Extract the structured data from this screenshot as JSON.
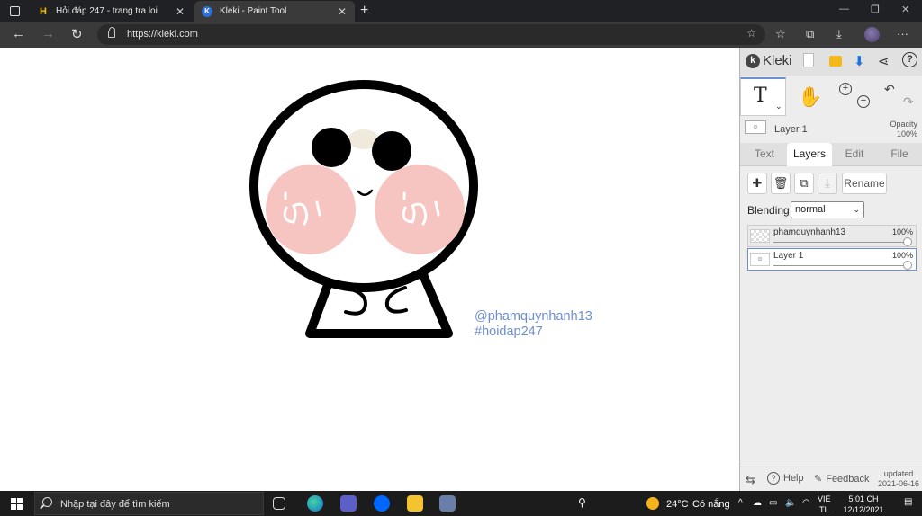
{
  "browser": {
    "tabs": [
      {
        "title": "Hỏi đáp 247 - trang tra loi",
        "favicon": "H",
        "active": false
      },
      {
        "title": "Kleki - Paint Tool",
        "favicon": "K",
        "active": true
      }
    ],
    "new_tab": "+",
    "url": "https://kleki.com"
  },
  "canvas": {
    "watermark_line1": "@phamquynhanh13",
    "watermark_line2": "#hoidap247",
    "watermark_color": "#6f8fcc"
  },
  "panel": {
    "brand": "Kleki",
    "active_tool": "T",
    "current_layer": "Layer 1",
    "opacity_label": "Opacity",
    "opacity_value": "100%",
    "tabs": [
      {
        "label": "Text",
        "active": false
      },
      {
        "label": "Layers",
        "active": true
      },
      {
        "label": "Edit",
        "active": false
      },
      {
        "label": "File",
        "active": false
      }
    ],
    "rename_label": "Rename",
    "blending_label": "Blending",
    "blending_value": "normal",
    "layers": [
      {
        "name": "phamquynhanh13",
        "opacity": "100%",
        "selected": false
      },
      {
        "name": "Layer 1",
        "opacity": "100%",
        "selected": true
      }
    ],
    "help_label": "Help",
    "feedback_label": "Feedback",
    "updated_line1": "updated",
    "updated_line2": "2021-06-16",
    "accent_color": "#6c8fd0"
  },
  "taskbar": {
    "search_placeholder": "Nhập tại đây để tìm kiếm",
    "weather_temp": "24°C",
    "weather_desc": "Có nắng",
    "lang_line1": "VIE",
    "lang_line2": "TL",
    "time": "5:01 CH",
    "date": "12/12/2021"
  }
}
